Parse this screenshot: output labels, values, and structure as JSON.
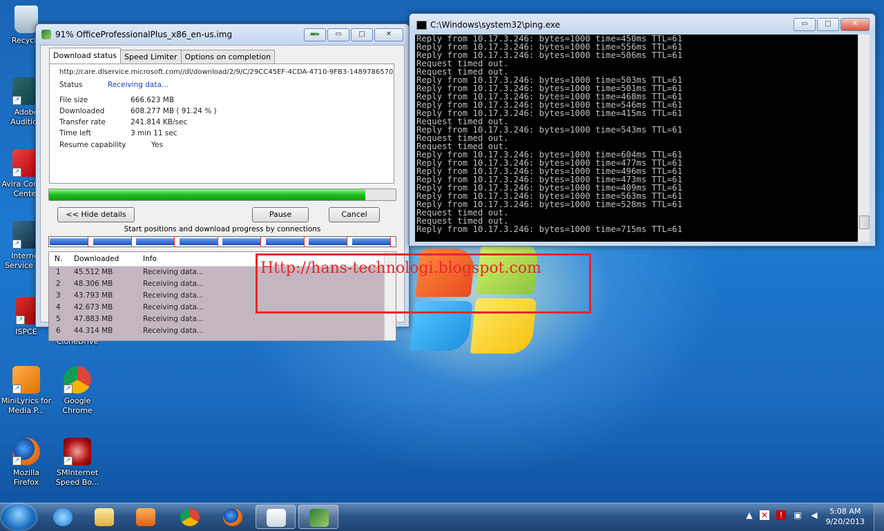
{
  "desktop": {
    "icons": [
      {
        "label": "Recycle"
      },
      {
        "label": "Adobe Audition"
      },
      {
        "label": "Avira Control Center"
      },
      {
        "label": "Internet Service S..."
      },
      {
        "label": "ISPCE"
      },
      {
        "label": "Virtual CloneDrive"
      },
      {
        "label": "MiniLyrics for Media P..."
      },
      {
        "label": "Google Chrome"
      },
      {
        "label": "Mozilla Firefox"
      },
      {
        "label": "SMInternet Speed Bo..."
      }
    ]
  },
  "idm": {
    "title": "91% OfficeProfessionalPlus_x86_en-us.img",
    "tabs": [
      "Download status",
      "Speed Limiter",
      "Options on completion"
    ],
    "url": "http://care.dlservice.microsoft.com//dl/download/2/9/C/29CC45EF-4CDA-4710-9FB3-1489786570",
    "fields": {
      "status_label": "Status",
      "status_value": "Receiving data...",
      "filesize_label": "File size",
      "filesize_value": "666.623  MB",
      "downloaded_label": "Downloaded",
      "downloaded_value": "608.277  MB  ( 91.24 % )",
      "rate_label": "Transfer rate",
      "rate_value": "241.814  KB/sec",
      "timeleft_label": "Time left",
      "timeleft_value": "3 min  11 sec",
      "resume_label": "Resume capability",
      "resume_value": "Yes"
    },
    "progress_percent": 91.24,
    "buttons": {
      "hide": "<< Hide details",
      "pause": "Pause",
      "cancel": "Cancel"
    },
    "connections_title": "Start positions and download progress by connections",
    "list": {
      "columns": [
        "N.",
        "Downloaded",
        "Info"
      ],
      "rows": [
        {
          "n": "1",
          "downloaded": "45.512  MB",
          "info": "Receiving data..."
        },
        {
          "n": "2",
          "downloaded": "48.306  MB",
          "info": "Receiving data..."
        },
        {
          "n": "3",
          "downloaded": "43.793  MB",
          "info": "Receiving data..."
        },
        {
          "n": "4",
          "downloaded": "42.673  MB",
          "info": "Receiving data..."
        },
        {
          "n": "5",
          "downloaded": "47.883  MB",
          "info": "Receiving data..."
        },
        {
          "n": "6",
          "downloaded": "44.314  MB",
          "info": "Receiving data..."
        }
      ]
    }
  },
  "console": {
    "title": "C:\\Windows\\system32\\ping.exe",
    "lines": [
      "Reply from 10.17.3.246: bytes=1000 time=450ms TTL=61",
      "Reply from 10.17.3.246: bytes=1000 time=556ms TTL=61",
      "Reply from 10.17.3.246: bytes=1000 time=506ms TTL=61",
      "Request timed out.",
      "Request timed out.",
      "Reply from 10.17.3.246: bytes=1000 time=503ms TTL=61",
      "Reply from 10.17.3.246: bytes=1000 time=501ms TTL=61",
      "Reply from 10.17.3.246: bytes=1000 time=468ms TTL=61",
      "Reply from 10.17.3.246: bytes=1000 time=546ms TTL=61",
      "Reply from 10.17.3.246: bytes=1000 time=415ms TTL=61",
      "Request timed out.",
      "Reply from 10.17.3.246: bytes=1000 time=543ms TTL=61",
      "Request timed out.",
      "Request timed out.",
      "Reply from 10.17.3.246: bytes=1000 time=604ms TTL=61",
      "Reply from 10.17.3.246: bytes=1000 time=477ms TTL=61",
      "Reply from 10.17.3.246: bytes=1000 time=496ms TTL=61",
      "Reply from 10.17.3.246: bytes=1000 time=473ms TTL=61",
      "Reply from 10.17.3.246: bytes=1000 time=409ms TTL=61",
      "Reply from 10.17.3.246: bytes=1000 time=563ms TTL=61",
      "Reply from 10.17.3.246: bytes=1000 time=528ms TTL=61",
      "Request timed out.",
      "Request timed out.",
      "Reply from 10.17.3.246: bytes=1000 time=715ms TTL=61"
    ]
  },
  "watermark": "Http://hans-technologi.blogspot.com",
  "taskbar": {
    "apps": [
      "internet-explorer",
      "windows-explorer",
      "media-player",
      "google-chrome",
      "firefox",
      "idm-window",
      "internet-download-manager"
    ],
    "time": "5:08 AM",
    "date": "9/20/2013"
  },
  "colors": {
    "accent_red": "#e8262e",
    "progress_green": "#1fbf1f",
    "link_blue": "#1a3fc0"
  }
}
